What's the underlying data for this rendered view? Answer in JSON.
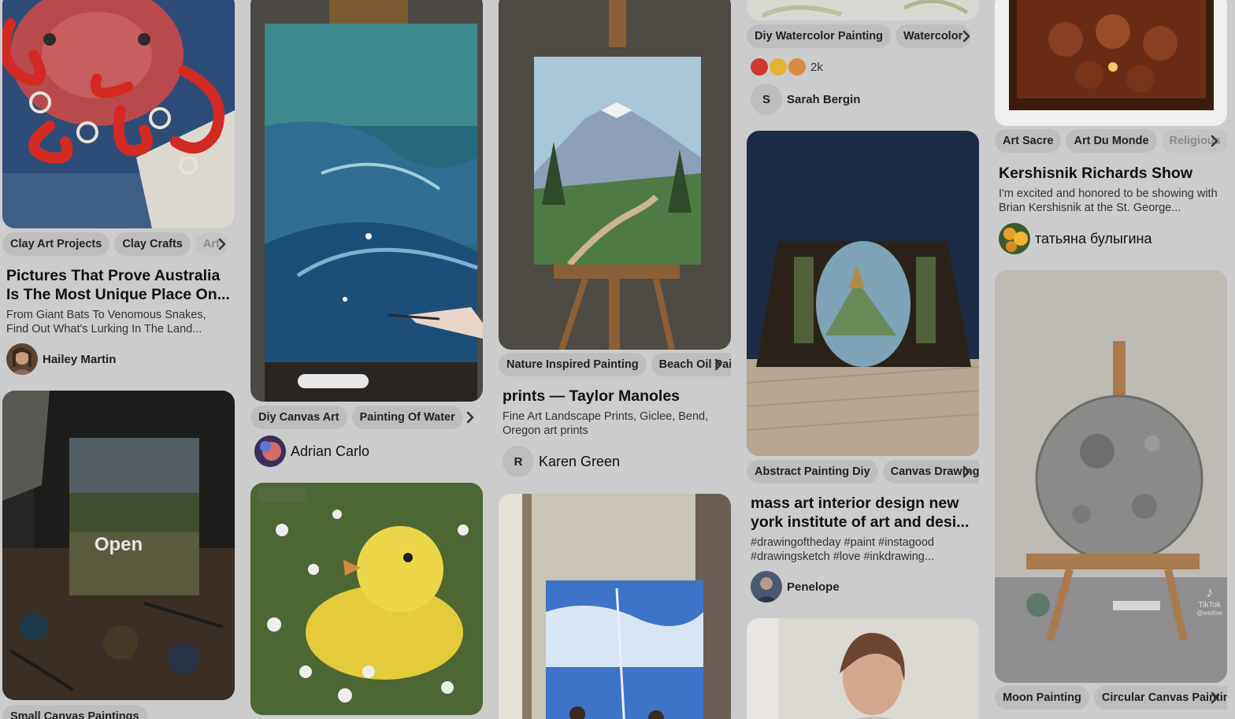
{
  "colors": {
    "background": "#cccccc",
    "tag_bg": "#bdbdbd",
    "text": "#111111"
  },
  "col1": {
    "pin1": {
      "tags": [
        "Clay Art Projects",
        "Clay Crafts",
        "Art"
      ],
      "title": "Pictures That Prove Australia Is The Most Unique Place On...",
      "desc": "From Giant Bats To Venomous Snakes, Find Out What's Lurking In The Land...",
      "author": "Hailey Martin"
    },
    "pin2": {
      "overlay": "Open",
      "tags": [
        "Small Canvas Paintings"
      ]
    }
  },
  "col2": {
    "pin1": {
      "tags": [
        "Diy Canvas Art",
        "Painting Of Water"
      ],
      "author": "Adrian Carlo"
    }
  },
  "col3": {
    "pin1": {
      "tags": [
        "Nature Inspired Painting",
        "Beach Oil Painting"
      ],
      "title": "prints — Taylor Manoles",
      "desc": "Fine Art Landscape Prints, Giclee, Bend, Oregon art prints",
      "author_initial": "R",
      "author": "Karen Green"
    }
  },
  "col4": {
    "pin1": {
      "tags": [
        "Diy Watercolor Painting",
        "Watercolor"
      ],
      "reaction_count": "2k",
      "author_initial": "S",
      "author": "Sarah Bergin"
    },
    "pin2": {
      "tags": [
        "Abstract Painting Diy",
        "Canvas Drawing"
      ],
      "title": "mass art interior design new york institute of art and desi...",
      "desc": "#drawingoftheday #paint #instagood #drawingsketch #love #inkdrawing...",
      "author": "Penelope"
    }
  },
  "col5": {
    "pin1": {
      "tags": [
        "Art Sacre",
        "Art Du Monde",
        "Religious"
      ],
      "title": "Kershisnik Richards Show",
      "desc": "I'm excited and honored to be showing with Brian Kershisnik at the St. George...",
      "author": "татьяна булыгина"
    },
    "pin2": {
      "watermark": "TikTok",
      "watermark_user": "@winfixe",
      "tags": [
        "Moon Painting",
        "Circular Canvas Painting"
      ]
    }
  }
}
